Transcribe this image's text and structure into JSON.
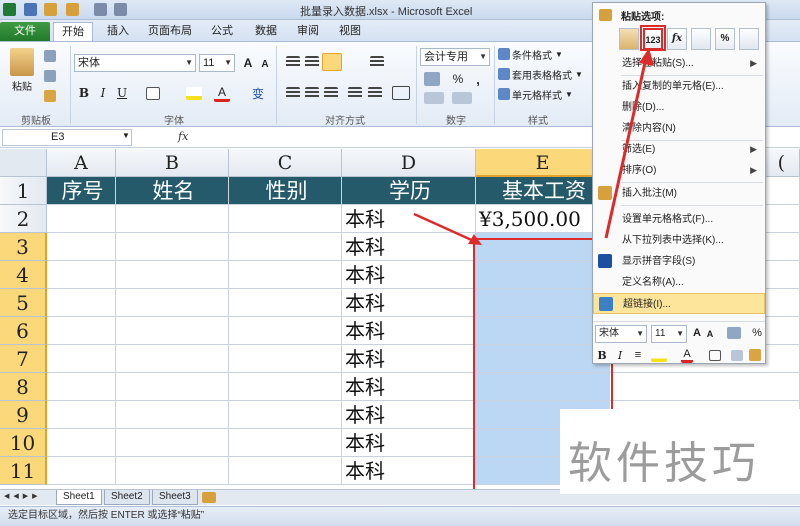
{
  "window": {
    "title": "批量录入数据.xlsx - Microsoft Excel"
  },
  "ribbon_tabs": [
    "文件",
    "开始",
    "插入",
    "页面布局",
    "公式",
    "数据",
    "审阅",
    "视图"
  ],
  "ribbon": {
    "clipboard": {
      "paste_label": "粘贴",
      "group_label": "剪贴板"
    },
    "font": {
      "font_name": "宋体",
      "font_size": "11",
      "group_label": "字体",
      "wen_label": "变"
    },
    "alignment": {
      "group_label": "对齐方式"
    },
    "number": {
      "format": "会计专用",
      "group_label": "数字",
      "percent": "%",
      "comma": ","
    },
    "styles": {
      "conditional": "条件格式",
      "table": "套用表格格式",
      "cell": "单元格样式",
      "group_label": "样式"
    }
  },
  "formula_bar": {
    "name_box": "E3",
    "fx": "fx",
    "content": ""
  },
  "columns": [
    "A",
    "B",
    "C",
    "D",
    "E"
  ],
  "rows": [
    {
      "n": "1",
      "cells": [
        "序号",
        "姓名",
        "性别",
        "学历",
        "基本工资"
      ]
    },
    {
      "n": "2",
      "cells": [
        "",
        "",
        "",
        "本科",
        "¥3,500.00"
      ]
    },
    {
      "n": "3",
      "cells": [
        "",
        "",
        "",
        "本科",
        ""
      ]
    },
    {
      "n": "4",
      "cells": [
        "",
        "",
        "",
        "本科",
        ""
      ]
    },
    {
      "n": "5",
      "cells": [
        "",
        "",
        "",
        "本科",
        ""
      ]
    },
    {
      "n": "6",
      "cells": [
        "",
        "",
        "",
        "本科",
        ""
      ]
    },
    {
      "n": "7",
      "cells": [
        "",
        "",
        "",
        "本科",
        ""
      ]
    },
    {
      "n": "8",
      "cells": [
        "",
        "",
        "",
        "本科",
        ""
      ]
    },
    {
      "n": "9",
      "cells": [
        "",
        "",
        "",
        "本科",
        ""
      ]
    },
    {
      "n": "10",
      "cells": [
        "",
        "",
        "",
        "本科",
        ""
      ]
    },
    {
      "n": "11",
      "cells": [
        "",
        "",
        "",
        "本科",
        ""
      ]
    }
  ],
  "extra_column": "(",
  "sheet_tabs": [
    "Sheet1",
    "Sheet2",
    "Sheet3"
  ],
  "status_text": "选定目标区域，然后按 ENTER 或选择“粘贴”",
  "context_menu": {
    "paste_options_label": "粘贴选项:",
    "paste_icons": [
      "clipboard",
      "123",
      "fx",
      "transpose",
      "%",
      "link"
    ],
    "items": [
      {
        "label": "选择性粘贴(S)...",
        "submenu": true
      },
      {
        "label": "插入复制的单元格(E)..."
      },
      {
        "label": "删除(D)..."
      },
      {
        "label": "清除内容(N)"
      },
      {
        "label": "筛选(E)",
        "submenu": true
      },
      {
        "label": "排序(O)",
        "submenu": true
      },
      {
        "label": "插入批注(M)"
      },
      {
        "label": "设置单元格格式(F)..."
      },
      {
        "label": "从下拉列表中选择(K)..."
      },
      {
        "label": "显示拼音字段(S)"
      },
      {
        "label": "定义名称(A)..."
      },
      {
        "label": "超链接(I)..."
      }
    ],
    "mini_toolbar": {
      "font": "宋体",
      "size": "11",
      "percent": "%",
      "comma": ","
    }
  },
  "watermark": "软件技巧",
  "colors": {
    "header_fill": "#245a6a",
    "selection_fill": "#bcd7f3",
    "annotation_red": "#dc2b2b",
    "file_tab_green": "#207a2a"
  }
}
